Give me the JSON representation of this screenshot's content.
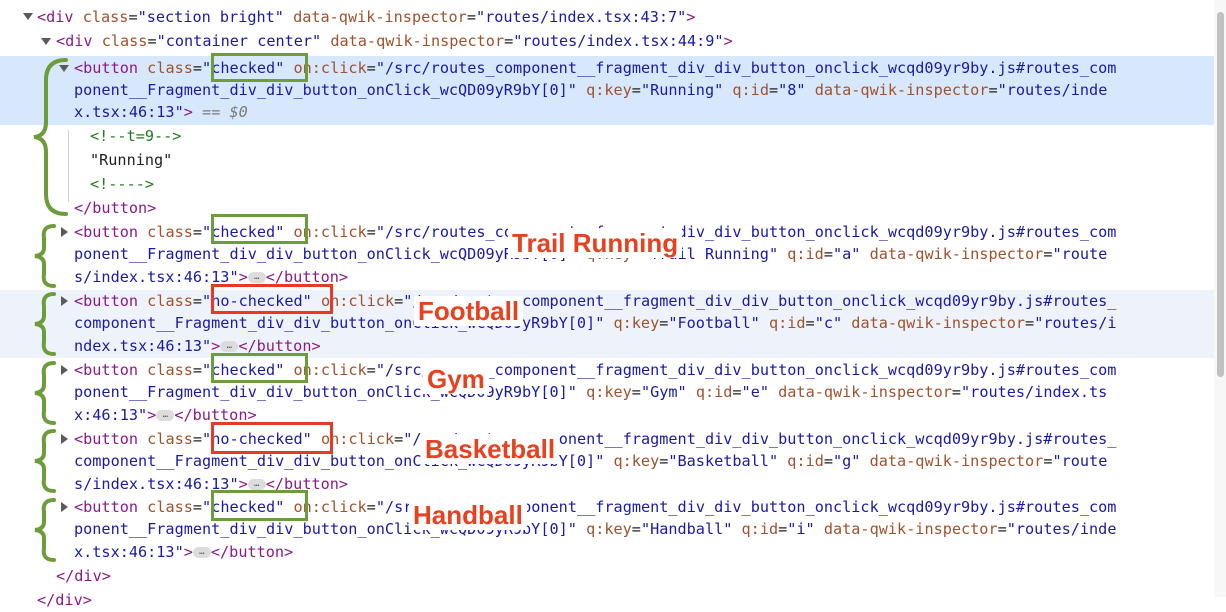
{
  "lines": [
    [
      [
        "t",
        "<div"
      ],
      [
        "p",
        " "
      ],
      [
        "a",
        "class"
      ],
      [
        "p",
        "="
      ],
      [
        "v",
        "\"section bright\""
      ],
      [
        "p",
        " "
      ],
      [
        "a",
        "data-qwik-inspector"
      ],
      [
        "p",
        "="
      ],
      [
        "v",
        "\"routes/index.tsx:43:7\""
      ],
      [
        "t",
        ">"
      ]
    ],
    [
      [
        "t",
        "<div"
      ],
      [
        "p",
        " "
      ],
      [
        "a",
        "class"
      ],
      [
        "p",
        "="
      ],
      [
        "v",
        "\"container center\""
      ],
      [
        "p",
        " "
      ],
      [
        "a",
        "data-qwik-inspector"
      ],
      [
        "p",
        "="
      ],
      [
        "v",
        "\"routes/index.tsx:44:9\""
      ],
      [
        "t",
        ">"
      ]
    ],
    [
      [
        "t",
        "<button"
      ],
      [
        "p",
        " "
      ],
      [
        "a",
        "class"
      ],
      [
        "p",
        "="
      ],
      [
        "v",
        "\"checked\""
      ],
      [
        "p",
        " "
      ],
      [
        "a",
        "on:click"
      ],
      [
        "p",
        "="
      ],
      [
        "v",
        "\"/src/routes_component__fragment_div_div_button_onclick_wcqd09yr9by.js#routes_com"
      ]
    ],
    [
      [
        "v",
        "ponent__Fragment_div_div_button_onClick_wcQD09yR9bY[0]\""
      ],
      [
        "p",
        " "
      ],
      [
        "a",
        "q:key"
      ],
      [
        "p",
        "="
      ],
      [
        "v",
        "\"Running\""
      ],
      [
        "p",
        " "
      ],
      [
        "a",
        "q:id"
      ],
      [
        "p",
        "="
      ],
      [
        "v",
        "\"8\""
      ],
      [
        "p",
        " "
      ],
      [
        "a",
        "data-qwik-inspector"
      ],
      [
        "p",
        "="
      ],
      [
        "v",
        "\"routes/inde"
      ]
    ],
    [
      [
        "v",
        "x.tsx:46:13\""
      ],
      [
        "t",
        ">"
      ],
      [
        "p",
        " "
      ],
      [
        "e",
        "== $0"
      ]
    ],
    [
      [
        "c",
        "<!--t=9-->"
      ]
    ],
    [
      [
        "p",
        "\"Running\""
      ]
    ],
    [
      [
        "c",
        "<!---->"
      ]
    ],
    [
      [
        "t",
        "</button>"
      ]
    ],
    [
      [
        "t",
        "<button"
      ],
      [
        "p",
        " "
      ],
      [
        "a",
        "class"
      ],
      [
        "p",
        "="
      ],
      [
        "v",
        "\"checked\""
      ],
      [
        "p",
        " "
      ],
      [
        "a",
        "on:click"
      ],
      [
        "p",
        "="
      ],
      [
        "v",
        "\"/src/routes_component__fragment_div_div_button_onclick_wcqd09yr9by.js#routes_com"
      ]
    ],
    [
      [
        "v",
        "ponent__Fragment_div_div_button_onClick_wcQD09yR9bY[0]\""
      ],
      [
        "p",
        " "
      ],
      [
        "a",
        "q:key"
      ],
      [
        "p",
        "="
      ],
      [
        "v",
        "\"Trail Running\""
      ],
      [
        "p",
        " "
      ],
      [
        "a",
        "q:id"
      ],
      [
        "p",
        "="
      ],
      [
        "v",
        "\"a\""
      ],
      [
        "p",
        " "
      ],
      [
        "a",
        "data-qwik-inspector"
      ],
      [
        "p",
        "="
      ],
      [
        "v",
        "\"route"
      ]
    ],
    [
      [
        "v",
        "s/index.tsx:46:13\""
      ],
      [
        "t",
        ">"
      ],
      [
        "d",
        "…"
      ],
      [
        "t",
        "</button>"
      ]
    ],
    [
      [
        "t",
        "<button"
      ],
      [
        "p",
        " "
      ],
      [
        "a",
        "class"
      ],
      [
        "p",
        "="
      ],
      [
        "v",
        "\"no-checked\""
      ],
      [
        "p",
        " "
      ],
      [
        "a",
        "on:click"
      ],
      [
        "p",
        "="
      ],
      [
        "v",
        "\"/src/routes_component__fragment_div_div_button_onclick_wcqd09yr9by.js#routes_"
      ]
    ],
    [
      [
        "v",
        "component__Fragment_div_div_button_onClick_wcQD09yR9bY[0]\""
      ],
      [
        "p",
        " "
      ],
      [
        "a",
        "q:key"
      ],
      [
        "p",
        "="
      ],
      [
        "v",
        "\"Football\""
      ],
      [
        "p",
        " "
      ],
      [
        "a",
        "q:id"
      ],
      [
        "p",
        "="
      ],
      [
        "v",
        "\"c\""
      ],
      [
        "p",
        " "
      ],
      [
        "a",
        "data-qwik-inspector"
      ],
      [
        "p",
        "="
      ],
      [
        "v",
        "\"routes/i"
      ]
    ],
    [
      [
        "v",
        "ndex.tsx:46:13\""
      ],
      [
        "t",
        ">"
      ],
      [
        "d",
        "…"
      ],
      [
        "t",
        "</button>"
      ]
    ],
    [
      [
        "t",
        "<button"
      ],
      [
        "p",
        " "
      ],
      [
        "a",
        "class"
      ],
      [
        "p",
        "="
      ],
      [
        "v",
        "\"checked\""
      ],
      [
        "p",
        " "
      ],
      [
        "a",
        "on:click"
      ],
      [
        "p",
        "="
      ],
      [
        "v",
        "\"/src/routes_component__fragment_div_div_button_onclick_wcqd09yr9by.js#routes_com"
      ]
    ],
    [
      [
        "v",
        "ponent__Fragment_div_div_button_onClick_wcQD09yR9bY[0]\""
      ],
      [
        "p",
        " "
      ],
      [
        "a",
        "q:key"
      ],
      [
        "p",
        "="
      ],
      [
        "v",
        "\"Gym\""
      ],
      [
        "p",
        " "
      ],
      [
        "a",
        "q:id"
      ],
      [
        "p",
        "="
      ],
      [
        "v",
        "\"e\""
      ],
      [
        "p",
        " "
      ],
      [
        "a",
        "data-qwik-inspector"
      ],
      [
        "p",
        "="
      ],
      [
        "v",
        "\"routes/index.ts"
      ]
    ],
    [
      [
        "v",
        "x:46:13\""
      ],
      [
        "t",
        ">"
      ],
      [
        "d",
        "…"
      ],
      [
        "t",
        "</button>"
      ]
    ],
    [
      [
        "t",
        "<button"
      ],
      [
        "p",
        " "
      ],
      [
        "a",
        "class"
      ],
      [
        "p",
        "="
      ],
      [
        "v",
        "\"no-checked\""
      ],
      [
        "p",
        " "
      ],
      [
        "a",
        "on:click"
      ],
      [
        "p",
        "="
      ],
      [
        "v",
        "\"/src/routes_component__fragment_div_div_button_onclick_wcqd09yr9by.js#routes_"
      ]
    ],
    [
      [
        "v",
        "component__Fragment_div_div_button_onClick_wcQD09yR9bY[0]\""
      ],
      [
        "p",
        " "
      ],
      [
        "a",
        "q:key"
      ],
      [
        "p",
        "="
      ],
      [
        "v",
        "\"Basketball\""
      ],
      [
        "p",
        " "
      ],
      [
        "a",
        "q:id"
      ],
      [
        "p",
        "="
      ],
      [
        "v",
        "\"g\""
      ],
      [
        "p",
        " "
      ],
      [
        "a",
        "data-qwik-inspector"
      ],
      [
        "p",
        "="
      ],
      [
        "v",
        "\"route"
      ]
    ],
    [
      [
        "v",
        "s/index.tsx:46:13\""
      ],
      [
        "t",
        ">"
      ],
      [
        "d",
        "…"
      ],
      [
        "t",
        "</button>"
      ]
    ],
    [
      [
        "t",
        "<button"
      ],
      [
        "p",
        " "
      ],
      [
        "a",
        "class"
      ],
      [
        "p",
        "="
      ],
      [
        "v",
        "\"checked\""
      ],
      [
        "p",
        " "
      ],
      [
        "a",
        "on:click"
      ],
      [
        "p",
        "="
      ],
      [
        "v",
        "\"/src/routes_component__fragment_div_div_button_onclick_wcqd09yr9by.js#routes_com"
      ]
    ],
    [
      [
        "v",
        "ponent__Fragment_div_div_button_onClick_wcQD09yR9bY[0]\""
      ],
      [
        "p",
        " "
      ],
      [
        "a",
        "q:key"
      ],
      [
        "p",
        "="
      ],
      [
        "v",
        "\"Handball\""
      ],
      [
        "p",
        " "
      ],
      [
        "a",
        "q:id"
      ],
      [
        "p",
        "="
      ],
      [
        "v",
        "\"i\""
      ],
      [
        "p",
        " "
      ],
      [
        "a",
        "data-qwik-inspector"
      ],
      [
        "p",
        "="
      ],
      [
        "v",
        "\"routes/inde"
      ]
    ],
    [
      [
        "v",
        "x.tsx:46:13\""
      ],
      [
        "t",
        ">"
      ],
      [
        "d",
        "…"
      ],
      [
        "t",
        "</button>"
      ]
    ],
    [
      [
        "t",
        "</div>"
      ]
    ],
    [
      [
        "t",
        "</div>"
      ]
    ]
  ],
  "annotations": {
    "labels": [
      "Trail Running",
      "Football",
      "Gym",
      "Basketball",
      "Handball"
    ],
    "colors": {
      "checked_box": "#6d9c3a",
      "no_checked_box": "#e53a23",
      "label_text": "#e8411f",
      "selected_row": "#d7e8fd"
    }
  },
  "icons": [
    "expand-triangle-icon",
    "collapse-triangle-icon",
    "ellipsis-icon"
  ]
}
